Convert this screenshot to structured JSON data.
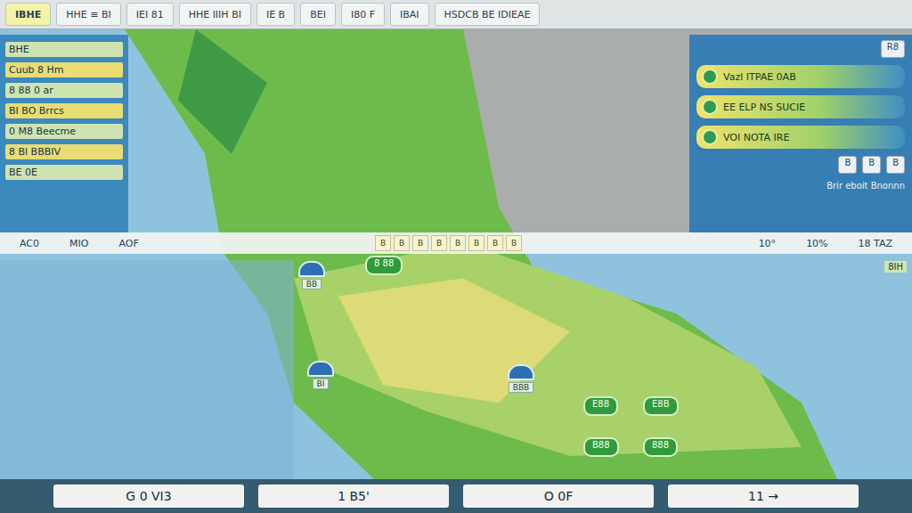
{
  "top_bar": {
    "tabs": [
      {
        "label": "IBHE",
        "selected": true
      },
      {
        "label": "HHE ≡ BI",
        "selected": false
      },
      {
        "label": "IEI 81",
        "selected": false
      },
      {
        "label": "HHE IIIH BI",
        "selected": false
      },
      {
        "label": "IE B",
        "selected": false
      },
      {
        "label": "BEI",
        "selected": false
      },
      {
        "label": "I80 F",
        "selected": false
      },
      {
        "label": "IBAI",
        "selected": false
      },
      {
        "label": "HSDCB BE IDIEAE",
        "selected": false
      }
    ]
  },
  "left_panel": {
    "lines": [
      "BHE",
      "Cuub 8 Hm",
      "8 88 0 ar",
      "BI BO Brrcs",
      "0 M8 Beecme",
      "8 Bl BBBIV",
      "BE 0E"
    ]
  },
  "right_panel": {
    "header_button": "R8",
    "cards": [
      "Vazl ITPAE 0AB",
      "EE ELP NS SUCIE",
      "VOI NOTA IRE"
    ],
    "buttons": [
      "B",
      "B",
      "B"
    ],
    "footer": "Brir eboit Bnonnn"
  },
  "info_bar": {
    "left": [
      "AC0",
      "MIO",
      "AOF"
    ],
    "keys": [
      "B",
      "B",
      "B",
      "B",
      "B",
      "B",
      "B",
      "B"
    ],
    "right": [
      "10°",
      "10%",
      "18 TAZ"
    ],
    "corner": "8IH"
  },
  "map": {
    "pins": [
      {
        "kind": "station",
        "label": "BB"
      },
      {
        "kind": "tag",
        "label": "8 88"
      },
      {
        "kind": "station",
        "label": "BI"
      },
      {
        "kind": "station",
        "label": "BBB"
      },
      {
        "kind": "tag",
        "label": "E88"
      },
      {
        "kind": "tag",
        "label": "E8B"
      },
      {
        "kind": "tag",
        "label": "B88"
      },
      {
        "kind": "tag",
        "label": "888"
      }
    ]
  },
  "bottom_bar": {
    "items": [
      "G 0 VI3",
      "1 B5'",
      "O 0F",
      "11 →"
    ]
  }
}
